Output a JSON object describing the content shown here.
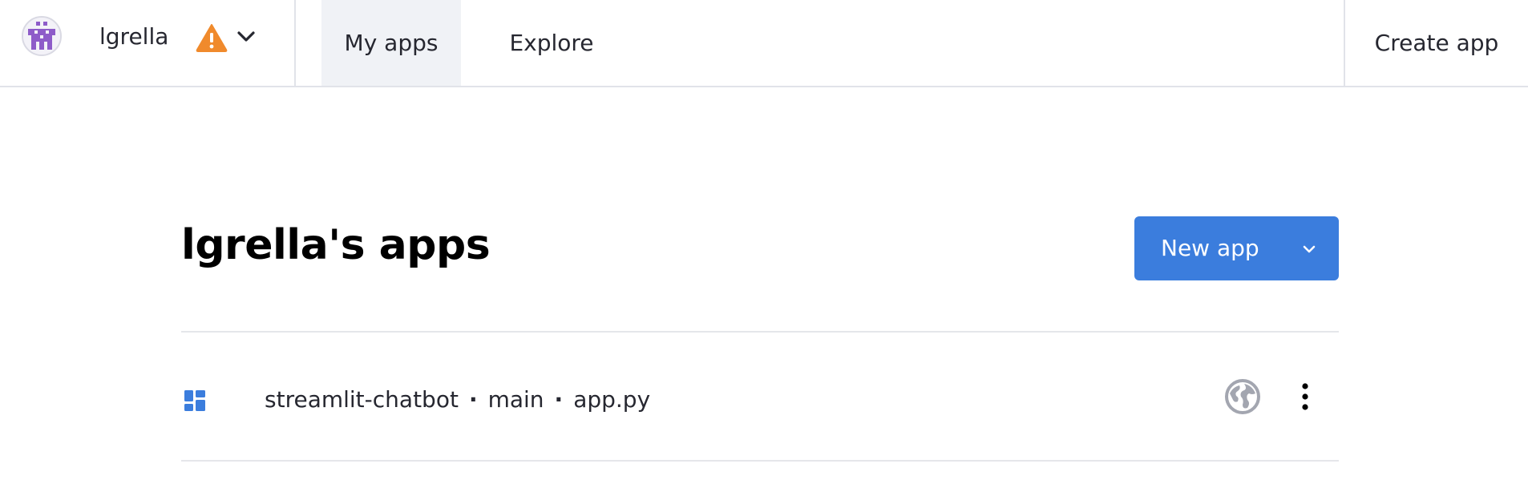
{
  "header": {
    "username": "lgrella",
    "tabs": [
      {
        "label": "My apps",
        "active": true
      },
      {
        "label": "Explore",
        "active": false
      }
    ],
    "create_app_label": "Create app",
    "warning_icon": "warning-triangle-icon",
    "warning_color": "#f08a2c"
  },
  "main": {
    "title": "lgrella's apps",
    "new_app_label": "New app",
    "accent_color": "#3b7ddd",
    "apps": [
      {
        "repo": "streamlit-chatbot",
        "branch": "main",
        "file": "app.py",
        "separator": "·",
        "visibility_icon": "globe-icon",
        "menu_icon": "kebab-menu-icon"
      }
    ]
  }
}
